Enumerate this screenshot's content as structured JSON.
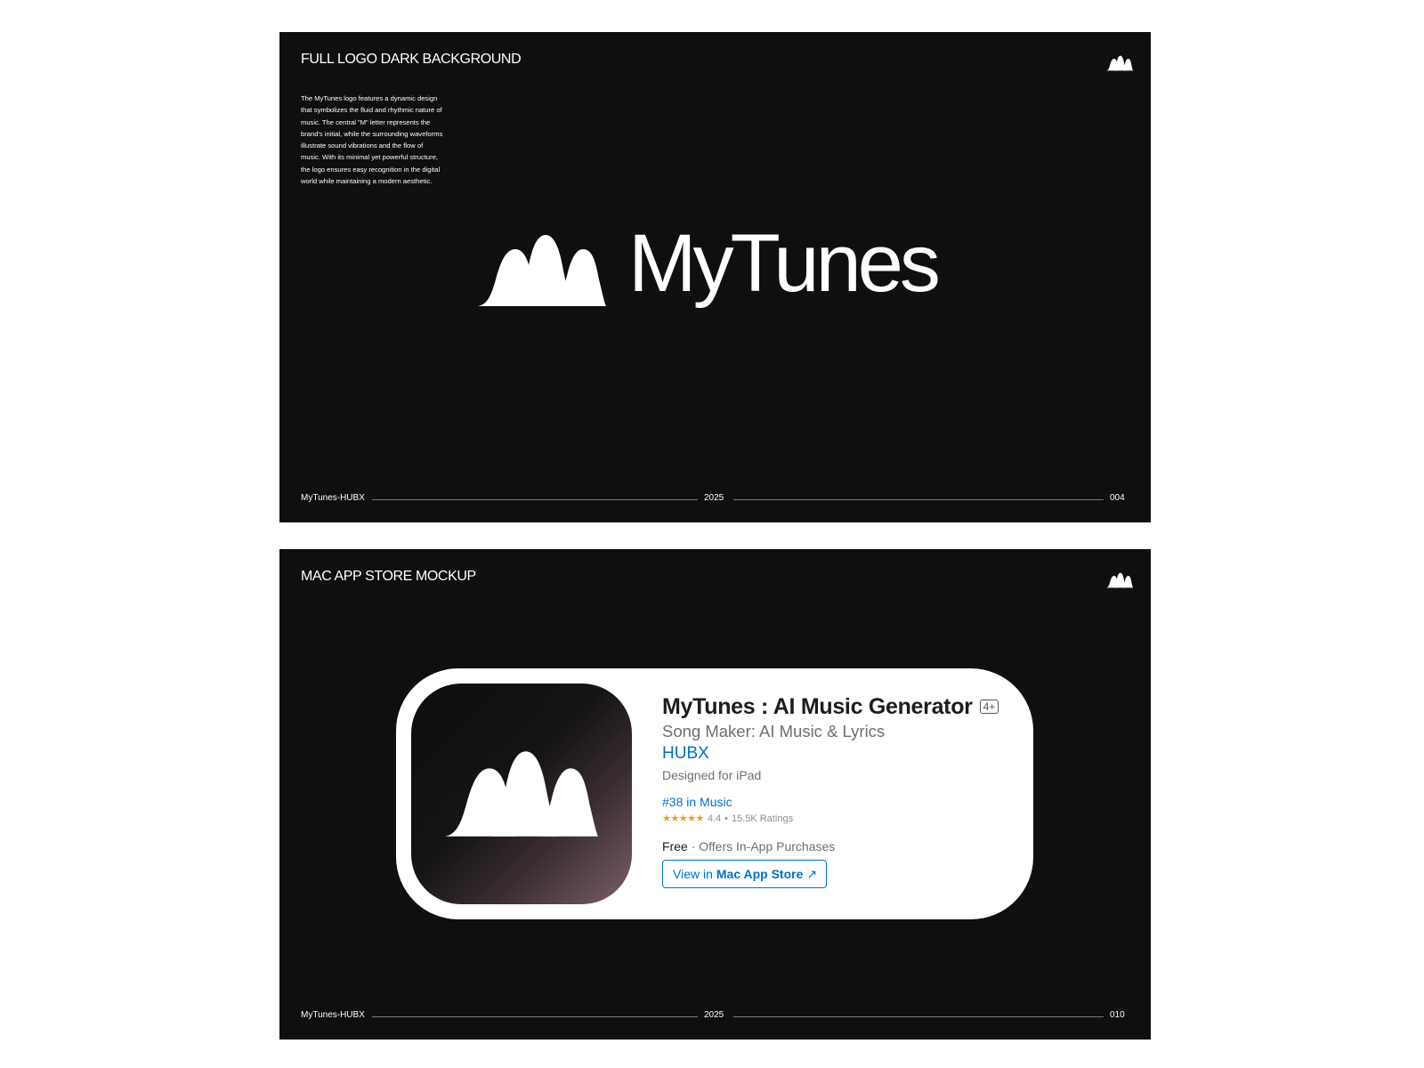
{
  "slide_1": {
    "title": "FULL LOGO DARK BACKGROUND",
    "description": "The MyTunes logo features a dynamic design that symbolizes the fluid and rhythmic nature of music. The central \"M\" letter represents the brand's initial, while the surrounding waveforms illustrate sound vibrations and the flow of music. With its minimal yet powerful structure, the logo ensures easy recognition in the digital world while maintaining a modern aesthetic.",
    "wordmark": "MyTunes",
    "footer_left": "MyTunes-HUBX",
    "footer_year": "2025",
    "page_number": "004"
  },
  "slide_2": {
    "title": "MAC APP STORE MOCKUP",
    "footer_left": "MyTunes-HUBX",
    "footer_year": "2025",
    "page_number": "010",
    "app": {
      "name": "MyTunes : AI Music Generator",
      "age_rating": "4+",
      "subtitle": "Song Maker: AI Music & Lyrics",
      "developer": "HUBX",
      "designed_for": "Designed for iPad",
      "rank": "#38 in Music",
      "stars": "★★★★★",
      "rating": "4.4",
      "rating_separator": "•",
      "ratings_count": "15.5K Ratings",
      "price": "Free",
      "price_separator": "·",
      "in_app": "Offers In-App Purchases",
      "button_prefix": "View in",
      "button_store": "Mac App Store",
      "button_arrow": "↗"
    }
  },
  "icons": [
    "mytunes-logo-icon",
    "external-link-arrow-icon",
    "star-rating-icon"
  ],
  "colors": {
    "slide_background": "#0f0f0f",
    "page_background": "#ffffff",
    "link_blue": "#0070c9",
    "star_orange": "#f19a2b"
  }
}
